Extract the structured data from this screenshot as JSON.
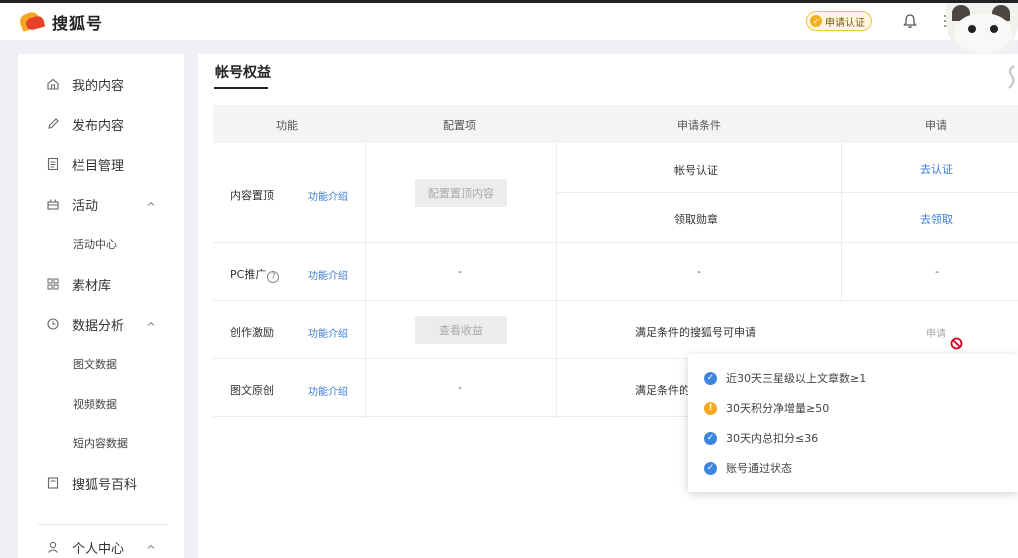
{
  "header": {
    "brand": "搜狐号",
    "cert_button": "申请认证",
    "cert_icon_glyph": "✓"
  },
  "sidebar": {
    "items": [
      {
        "label": "我的内容",
        "icon": "home-icon"
      },
      {
        "label": "发布内容",
        "icon": "pen-icon"
      },
      {
        "label": "栏目管理",
        "icon": "document-icon"
      },
      {
        "label": "活动",
        "icon": "gift-icon",
        "expanded": true
      },
      {
        "label": "素材库",
        "icon": "grid-icon"
      },
      {
        "label": "数据分析",
        "icon": "clock-icon",
        "expanded": true
      },
      {
        "label": "搜狐号百科",
        "icon": "book-icon"
      },
      {
        "label": "个人中心",
        "icon": "user-icon",
        "expanded": true
      }
    ],
    "sub_activity": [
      "活动中心"
    ],
    "sub_data": [
      "图文数据",
      "视频数据",
      "短内容数据"
    ]
  },
  "main": {
    "title": "帐号权益",
    "columns": [
      "功能",
      "配置项",
      "申请条件",
      "申请"
    ],
    "feature_intro": "功能介绍",
    "rows": {
      "top": {
        "name": "内容置顶",
        "config_button": "配置置顶内容",
        "conditions": [
          "帐号认证",
          "领取勋章"
        ],
        "actions": [
          "去认证",
          "去领取"
        ]
      },
      "pc": {
        "name": "PC推广",
        "help_glyph": "?",
        "config": "-",
        "condition": "-",
        "action": "-"
      },
      "incentive": {
        "name": "创作激励",
        "config_button": "查看收益",
        "condition": "满足条件的搜狐号可申请",
        "action": "申请"
      },
      "original": {
        "name": "图文原创",
        "config": "-",
        "condition": "满足条件的"
      }
    }
  },
  "popup": {
    "items": [
      {
        "text": "近30天三星级以上文章数≥1",
        "status": "ok"
      },
      {
        "text": "30天积分净增量≥50",
        "status": "warn"
      },
      {
        "text": "30天内总扣分≤36",
        "status": "ok"
      },
      {
        "text": "账号通过状态",
        "status": "ok"
      }
    ],
    "ok_glyph": "✓",
    "warn_glyph": "!"
  },
  "colors": {
    "link": "#3b7bd6",
    "ok": "#3d85e0",
    "warn": "#f5a623",
    "forbid": "#d0021b"
  }
}
